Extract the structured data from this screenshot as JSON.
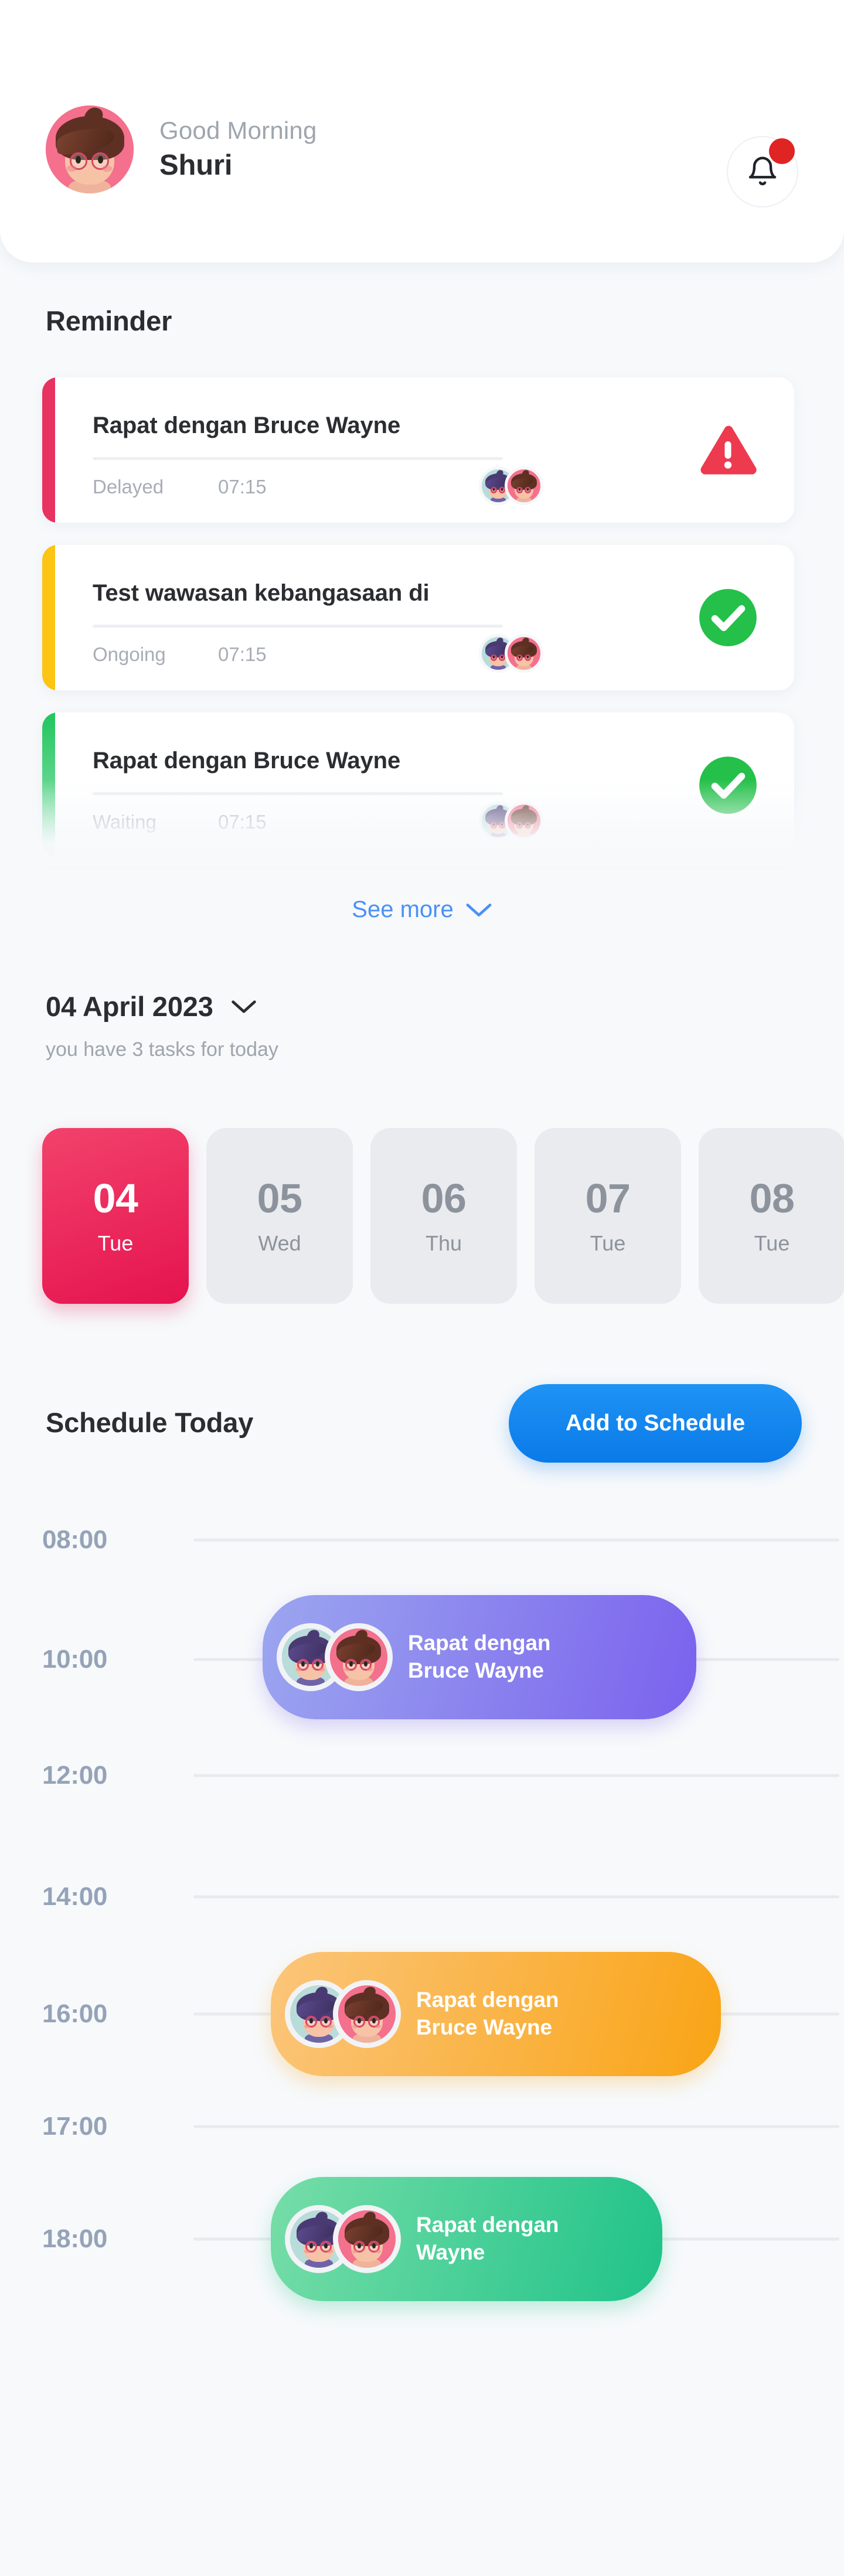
{
  "header": {
    "greeting": "Good Morning",
    "name": "Shuri",
    "bell_icon": "bell-icon",
    "notification_dot": true
  },
  "reminder": {
    "title": "Reminder",
    "see_more_label": "See more",
    "see_more_icon": "chevron-down-icon",
    "see_more_color": "#4a90f7",
    "items": [
      {
        "title": "Rapat dengan Bruce Wayne",
        "status": "Delayed",
        "time": "07:15",
        "accent": "#e8325f",
        "state_icon": "warning-triangle-icon",
        "state_icon_color": "#ed3a4f"
      },
      {
        "title": "Test wawasan kebangasaan di",
        "status": "Ongoing",
        "time": "07:15",
        "accent": "#fcc413",
        "state_icon": "check-circle-icon",
        "state_icon_color": "#24c04a"
      },
      {
        "title": "Rapat dengan Bruce Wayne",
        "status": "Waiting",
        "time": "07:15",
        "accent": "#21c55d",
        "state_icon": "check-circle-icon",
        "state_icon_color": "#24c04a"
      }
    ]
  },
  "date_section": {
    "date_label": "04 April 2023",
    "date_chevron_icon": "chevron-down-icon",
    "tasks_summary": "you have 3 tasks for today",
    "days": [
      {
        "num": "04",
        "day": "Tue",
        "active": true
      },
      {
        "num": "05",
        "day": "Wed",
        "active": false
      },
      {
        "num": "06",
        "day": "Thu",
        "active": false
      },
      {
        "num": "07",
        "day": "Tue",
        "active": false
      },
      {
        "num": "08",
        "day": "Tue",
        "active": false
      }
    ],
    "active_color": "#e5134f"
  },
  "schedule": {
    "title": "Schedule Today",
    "add_button_label": "Add to Schedule",
    "add_button_color": "#0f84ef",
    "times": [
      "08:00",
      "10:00",
      "12:00",
      "14:00",
      "16:00",
      "17:00",
      "18:00"
    ],
    "events": [
      {
        "time": "10:00",
        "title": "Rapat dengan Bruce Wayne",
        "color": "#7b62ee",
        "attendees": 2
      },
      {
        "time": "16:00",
        "title": "Rapat dengan Bruce Wayne",
        "color": "#f9a415",
        "attendees": 2
      },
      {
        "time": "18:00",
        "title": "Rapat dengan Wayne",
        "color": "#1fc389",
        "attendees": 2
      }
    ]
  }
}
